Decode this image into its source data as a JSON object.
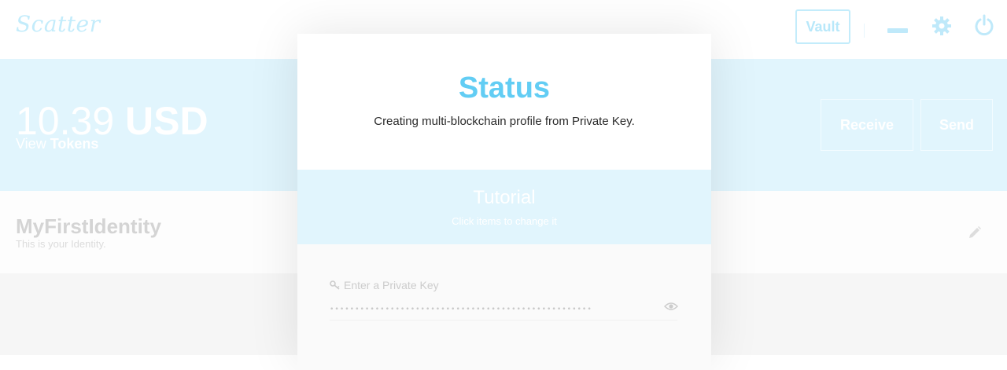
{
  "app": {
    "logo": "Scatter",
    "vault_label": "Vault",
    "colors": {
      "accent": "#62cdf4",
      "band": "#e1f5fd",
      "muted": "#c3ecfb"
    }
  },
  "balance": {
    "amount": "10.39",
    "currency": "USD",
    "view_prefix": "View",
    "view_link": "Tokens",
    "receive_label": "Receive",
    "send_label": "Send"
  },
  "identity": {
    "name": "MyFirstIdentity",
    "subtitle": "This is your Identity."
  },
  "modal": {
    "title": "Status",
    "message": "Creating multi-blockchain profile from Private Key.",
    "tutorial_title": "Tutorial",
    "tutorial_sub": "Click items to change it",
    "key_label": "Enter a Private Key",
    "key_value": "••••••••••••••••••••••••••••••••••••••••••••••••••••"
  },
  "icons": [
    "minimize-icon",
    "gear-icon",
    "power-icon",
    "pencil-icon",
    "key-icon",
    "eye-icon"
  ]
}
